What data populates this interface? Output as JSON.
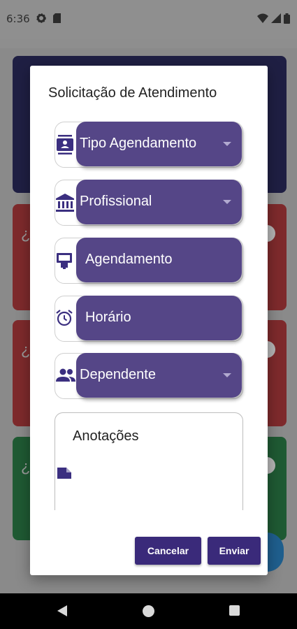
{
  "status_bar": {
    "time": "6:36",
    "icons": [
      "settings-icon",
      "sim-card-icon",
      "wifi-icon",
      "signal-icon",
      "battery-icon"
    ]
  },
  "dialog": {
    "title": "Solicitação de Atendimento",
    "fields": [
      {
        "label": "Tipo Agendamento",
        "icon": "badge-icon",
        "dropdown": true
      },
      {
        "label": "Profissional",
        "icon": "bank-icon",
        "dropdown": true
      },
      {
        "label": "Agendamento",
        "icon": "calendar-card-icon",
        "dropdown": false
      },
      {
        "label": "Horário",
        "icon": "alarm-clock-icon",
        "dropdown": false
      },
      {
        "label": "Dependente",
        "icon": "people-icon",
        "dropdown": true
      }
    ],
    "notes": {
      "label": "Anotações",
      "icon": "note-icon"
    },
    "buttons": {
      "cancel": "Cancelar",
      "send": "Enviar"
    }
  },
  "colors": {
    "accent": "#554687",
    "button": "#3a2a7a",
    "icon": "#3b2f80"
  }
}
